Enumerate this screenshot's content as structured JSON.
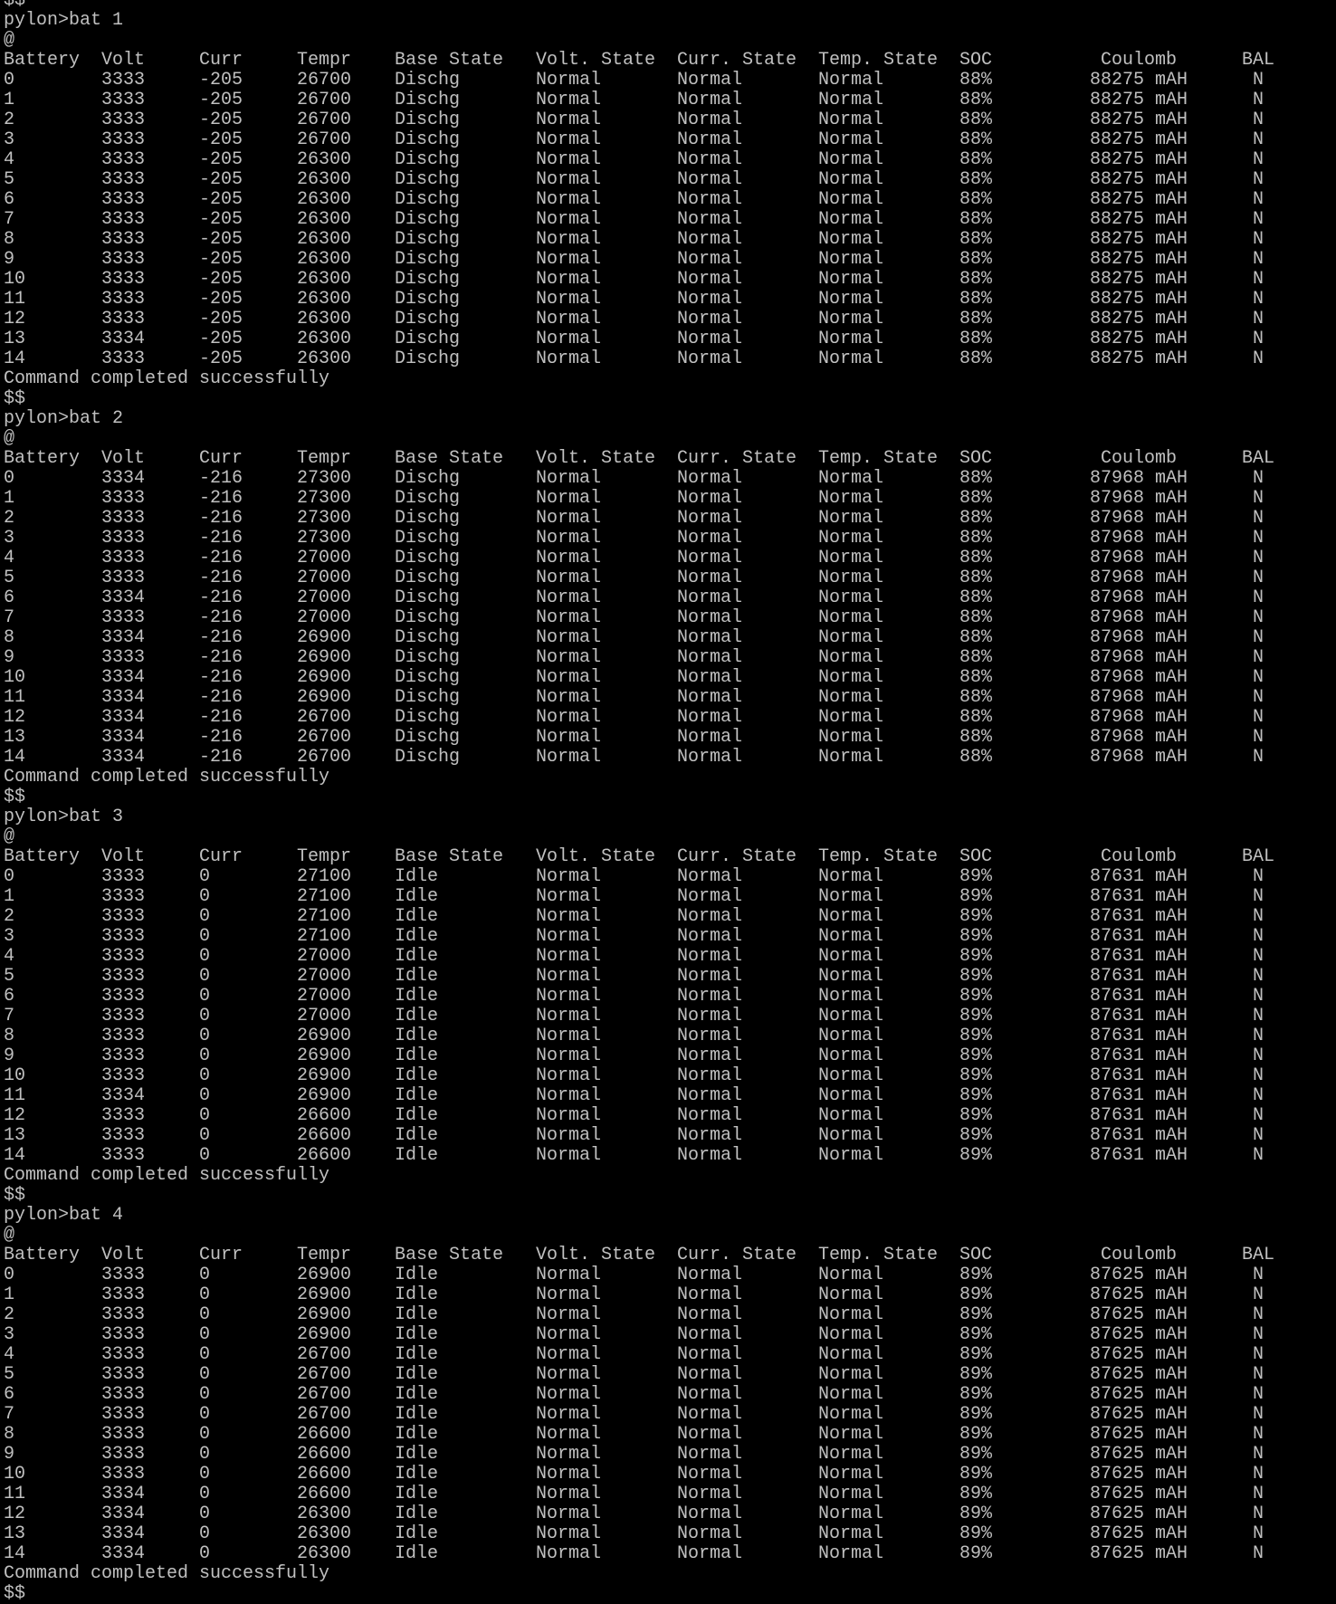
{
  "terminal": {
    "prompt_marker": "$$",
    "ack_marker": "@",
    "status_message": "Command completed successfully",
    "headers": [
      "Battery",
      "Volt",
      "Curr",
      "Tempr",
      "Base State",
      "Volt. State",
      "Curr. State",
      "Temp. State",
      "SOC",
      "Coulomb",
      "BAL"
    ],
    "blocks": [
      {
        "command": "pylon>bat 1",
        "rows": [
          [
            "0",
            "3333",
            "-205",
            "26700",
            "Dischg",
            "Normal",
            "Normal",
            "Normal",
            "88%",
            "88275 mAH",
            "N"
          ],
          [
            "1",
            "3333",
            "-205",
            "26700",
            "Dischg",
            "Normal",
            "Normal",
            "Normal",
            "88%",
            "88275 mAH",
            "N"
          ],
          [
            "2",
            "3333",
            "-205",
            "26700",
            "Dischg",
            "Normal",
            "Normal",
            "Normal",
            "88%",
            "88275 mAH",
            "N"
          ],
          [
            "3",
            "3333",
            "-205",
            "26700",
            "Dischg",
            "Normal",
            "Normal",
            "Normal",
            "88%",
            "88275 mAH",
            "N"
          ],
          [
            "4",
            "3333",
            "-205",
            "26300",
            "Dischg",
            "Normal",
            "Normal",
            "Normal",
            "88%",
            "88275 mAH",
            "N"
          ],
          [
            "5",
            "3333",
            "-205",
            "26300",
            "Dischg",
            "Normal",
            "Normal",
            "Normal",
            "88%",
            "88275 mAH",
            "N"
          ],
          [
            "6",
            "3333",
            "-205",
            "26300",
            "Dischg",
            "Normal",
            "Normal",
            "Normal",
            "88%",
            "88275 mAH",
            "N"
          ],
          [
            "7",
            "3333",
            "-205",
            "26300",
            "Dischg",
            "Normal",
            "Normal",
            "Normal",
            "88%",
            "88275 mAH",
            "N"
          ],
          [
            "8",
            "3333",
            "-205",
            "26300",
            "Dischg",
            "Normal",
            "Normal",
            "Normal",
            "88%",
            "88275 mAH",
            "N"
          ],
          [
            "9",
            "3333",
            "-205",
            "26300",
            "Dischg",
            "Normal",
            "Normal",
            "Normal",
            "88%",
            "88275 mAH",
            "N"
          ],
          [
            "10",
            "3333",
            "-205",
            "26300",
            "Dischg",
            "Normal",
            "Normal",
            "Normal",
            "88%",
            "88275 mAH",
            "N"
          ],
          [
            "11",
            "3333",
            "-205",
            "26300",
            "Dischg",
            "Normal",
            "Normal",
            "Normal",
            "88%",
            "88275 mAH",
            "N"
          ],
          [
            "12",
            "3333",
            "-205",
            "26300",
            "Dischg",
            "Normal",
            "Normal",
            "Normal",
            "88%",
            "88275 mAH",
            "N"
          ],
          [
            "13",
            "3334",
            "-205",
            "26300",
            "Dischg",
            "Normal",
            "Normal",
            "Normal",
            "88%",
            "88275 mAH",
            "N"
          ],
          [
            "14",
            "3333",
            "-205",
            "26300",
            "Dischg",
            "Normal",
            "Normal",
            "Normal",
            "88%",
            "88275 mAH",
            "N"
          ]
        ]
      },
      {
        "command": "pylon>bat 2",
        "rows": [
          [
            "0",
            "3334",
            "-216",
            "27300",
            "Dischg",
            "Normal",
            "Normal",
            "Normal",
            "88%",
            "87968 mAH",
            "N"
          ],
          [
            "1",
            "3333",
            "-216",
            "27300",
            "Dischg",
            "Normal",
            "Normal",
            "Normal",
            "88%",
            "87968 mAH",
            "N"
          ],
          [
            "2",
            "3333",
            "-216",
            "27300",
            "Dischg",
            "Normal",
            "Normal",
            "Normal",
            "88%",
            "87968 mAH",
            "N"
          ],
          [
            "3",
            "3333",
            "-216",
            "27300",
            "Dischg",
            "Normal",
            "Normal",
            "Normal",
            "88%",
            "87968 mAH",
            "N"
          ],
          [
            "4",
            "3333",
            "-216",
            "27000",
            "Dischg",
            "Normal",
            "Normal",
            "Normal",
            "88%",
            "87968 mAH",
            "N"
          ],
          [
            "5",
            "3333",
            "-216",
            "27000",
            "Dischg",
            "Normal",
            "Normal",
            "Normal",
            "88%",
            "87968 mAH",
            "N"
          ],
          [
            "6",
            "3334",
            "-216",
            "27000",
            "Dischg",
            "Normal",
            "Normal",
            "Normal",
            "88%",
            "87968 mAH",
            "N"
          ],
          [
            "7",
            "3333",
            "-216",
            "27000",
            "Dischg",
            "Normal",
            "Normal",
            "Normal",
            "88%",
            "87968 mAH",
            "N"
          ],
          [
            "8",
            "3334",
            "-216",
            "26900",
            "Dischg",
            "Normal",
            "Normal",
            "Normal",
            "88%",
            "87968 mAH",
            "N"
          ],
          [
            "9",
            "3333",
            "-216",
            "26900",
            "Dischg",
            "Normal",
            "Normal",
            "Normal",
            "88%",
            "87968 mAH",
            "N"
          ],
          [
            "10",
            "3334",
            "-216",
            "26900",
            "Dischg",
            "Normal",
            "Normal",
            "Normal",
            "88%",
            "87968 mAH",
            "N"
          ],
          [
            "11",
            "3334",
            "-216",
            "26900",
            "Dischg",
            "Normal",
            "Normal",
            "Normal",
            "88%",
            "87968 mAH",
            "N"
          ],
          [
            "12",
            "3334",
            "-216",
            "26700",
            "Dischg",
            "Normal",
            "Normal",
            "Normal",
            "88%",
            "87968 mAH",
            "N"
          ],
          [
            "13",
            "3334",
            "-216",
            "26700",
            "Dischg",
            "Normal",
            "Normal",
            "Normal",
            "88%",
            "87968 mAH",
            "N"
          ],
          [
            "14",
            "3334",
            "-216",
            "26700",
            "Dischg",
            "Normal",
            "Normal",
            "Normal",
            "88%",
            "87968 mAH",
            "N"
          ]
        ]
      },
      {
        "command": "pylon>bat 3",
        "rows": [
          [
            "0",
            "3333",
            "0",
            "27100",
            "Idle",
            "Normal",
            "Normal",
            "Normal",
            "89%",
            "87631 mAH",
            "N"
          ],
          [
            "1",
            "3333",
            "0",
            "27100",
            "Idle",
            "Normal",
            "Normal",
            "Normal",
            "89%",
            "87631 mAH",
            "N"
          ],
          [
            "2",
            "3333",
            "0",
            "27100",
            "Idle",
            "Normal",
            "Normal",
            "Normal",
            "89%",
            "87631 mAH",
            "N"
          ],
          [
            "3",
            "3333",
            "0",
            "27100",
            "Idle",
            "Normal",
            "Normal",
            "Normal",
            "89%",
            "87631 mAH",
            "N"
          ],
          [
            "4",
            "3333",
            "0",
            "27000",
            "Idle",
            "Normal",
            "Normal",
            "Normal",
            "89%",
            "87631 mAH",
            "N"
          ],
          [
            "5",
            "3333",
            "0",
            "27000",
            "Idle",
            "Normal",
            "Normal",
            "Normal",
            "89%",
            "87631 mAH",
            "N"
          ],
          [
            "6",
            "3333",
            "0",
            "27000",
            "Idle",
            "Normal",
            "Normal",
            "Normal",
            "89%",
            "87631 mAH",
            "N"
          ],
          [
            "7",
            "3333",
            "0",
            "27000",
            "Idle",
            "Normal",
            "Normal",
            "Normal",
            "89%",
            "87631 mAH",
            "N"
          ],
          [
            "8",
            "3333",
            "0",
            "26900",
            "Idle",
            "Normal",
            "Normal",
            "Normal",
            "89%",
            "87631 mAH",
            "N"
          ],
          [
            "9",
            "3333",
            "0",
            "26900",
            "Idle",
            "Normal",
            "Normal",
            "Normal",
            "89%",
            "87631 mAH",
            "N"
          ],
          [
            "10",
            "3333",
            "0",
            "26900",
            "Idle",
            "Normal",
            "Normal",
            "Normal",
            "89%",
            "87631 mAH",
            "N"
          ],
          [
            "11",
            "3334",
            "0",
            "26900",
            "Idle",
            "Normal",
            "Normal",
            "Normal",
            "89%",
            "87631 mAH",
            "N"
          ],
          [
            "12",
            "3333",
            "0",
            "26600",
            "Idle",
            "Normal",
            "Normal",
            "Normal",
            "89%",
            "87631 mAH",
            "N"
          ],
          [
            "13",
            "3333",
            "0",
            "26600",
            "Idle",
            "Normal",
            "Normal",
            "Normal",
            "89%",
            "87631 mAH",
            "N"
          ],
          [
            "14",
            "3333",
            "0",
            "26600",
            "Idle",
            "Normal",
            "Normal",
            "Normal",
            "89%",
            "87631 mAH",
            "N"
          ]
        ]
      },
      {
        "command": "pylon>bat 4",
        "rows": [
          [
            "0",
            "3333",
            "0",
            "26900",
            "Idle",
            "Normal",
            "Normal",
            "Normal",
            "89%",
            "87625 mAH",
            "N"
          ],
          [
            "1",
            "3333",
            "0",
            "26900",
            "Idle",
            "Normal",
            "Normal",
            "Normal",
            "89%",
            "87625 mAH",
            "N"
          ],
          [
            "2",
            "3333",
            "0",
            "26900",
            "Idle",
            "Normal",
            "Normal",
            "Normal",
            "89%",
            "87625 mAH",
            "N"
          ],
          [
            "3",
            "3333",
            "0",
            "26900",
            "Idle",
            "Normal",
            "Normal",
            "Normal",
            "89%",
            "87625 mAH",
            "N"
          ],
          [
            "4",
            "3333",
            "0",
            "26700",
            "Idle",
            "Normal",
            "Normal",
            "Normal",
            "89%",
            "87625 mAH",
            "N"
          ],
          [
            "5",
            "3333",
            "0",
            "26700",
            "Idle",
            "Normal",
            "Normal",
            "Normal",
            "89%",
            "87625 mAH",
            "N"
          ],
          [
            "6",
            "3333",
            "0",
            "26700",
            "Idle",
            "Normal",
            "Normal",
            "Normal",
            "89%",
            "87625 mAH",
            "N"
          ],
          [
            "7",
            "3333",
            "0",
            "26700",
            "Idle",
            "Normal",
            "Normal",
            "Normal",
            "89%",
            "87625 mAH",
            "N"
          ],
          [
            "8",
            "3333",
            "0",
            "26600",
            "Idle",
            "Normal",
            "Normal",
            "Normal",
            "89%",
            "87625 mAH",
            "N"
          ],
          [
            "9",
            "3333",
            "0",
            "26600",
            "Idle",
            "Normal",
            "Normal",
            "Normal",
            "89%",
            "87625 mAH",
            "N"
          ],
          [
            "10",
            "3333",
            "0",
            "26600",
            "Idle",
            "Normal",
            "Normal",
            "Normal",
            "89%",
            "87625 mAH",
            "N"
          ],
          [
            "11",
            "3334",
            "0",
            "26600",
            "Idle",
            "Normal",
            "Normal",
            "Normal",
            "89%",
            "87625 mAH",
            "N"
          ],
          [
            "12",
            "3334",
            "0",
            "26300",
            "Idle",
            "Normal",
            "Normal",
            "Normal",
            "89%",
            "87625 mAH",
            "N"
          ],
          [
            "13",
            "3334",
            "0",
            "26300",
            "Idle",
            "Normal",
            "Normal",
            "Normal",
            "89%",
            "87625 mAH",
            "N"
          ],
          [
            "14",
            "3334",
            "0",
            "26300",
            "Idle",
            "Normal",
            "Normal",
            "Normal",
            "89%",
            "87625 mAH",
            "N"
          ]
        ]
      }
    ]
  }
}
